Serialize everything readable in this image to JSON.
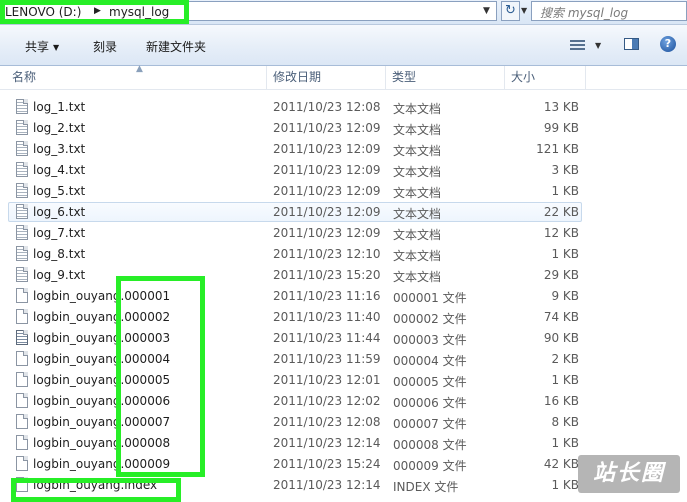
{
  "address_bar": {
    "drive": "LENOVO (D:)",
    "folder": "mysql_log"
  },
  "search": {
    "placeholder": "搜索 mysql_log"
  },
  "toolbar": {
    "share_label": "共享",
    "burn_label": "刻录",
    "new_folder_label": "新建文件夹"
  },
  "columns": {
    "name": "名称",
    "date": "修改日期",
    "type": "类型",
    "size": "大小"
  },
  "files": [
    {
      "name": "log_1.txt",
      "date": "2011/10/23 12:08",
      "type": "文本文档",
      "size": "13 KB"
    },
    {
      "name": "log_2.txt",
      "date": "2011/10/23 12:09",
      "type": "文本文档",
      "size": "99 KB"
    },
    {
      "name": "log_3.txt",
      "date": "2011/10/23 12:09",
      "type": "文本文档",
      "size": "121 KB"
    },
    {
      "name": "log_4.txt",
      "date": "2011/10/23 12:09",
      "type": "文本文档",
      "size": "3 KB"
    },
    {
      "name": "log_5.txt",
      "date": "2011/10/23 12:09",
      "type": "文本文档",
      "size": "1 KB"
    },
    {
      "name": "log_6.txt",
      "date": "2011/10/23 12:09",
      "type": "文本文档",
      "size": "22 KB"
    },
    {
      "name": "log_7.txt",
      "date": "2011/10/23 12:09",
      "type": "文本文档",
      "size": "12 KB"
    },
    {
      "name": "log_8.txt",
      "date": "2011/10/23 12:10",
      "type": "文本文档",
      "size": "1 KB"
    },
    {
      "name": "log_9.txt",
      "date": "2011/10/23 15:20",
      "type": "文本文档",
      "size": "29 KB"
    },
    {
      "name": "logbin_ouyang.000001",
      "date": "2011/10/23 11:16",
      "type": "000001 文件",
      "size": "9 KB"
    },
    {
      "name": "logbin_ouyang.000002",
      "date": "2011/10/23 11:40",
      "type": "000002 文件",
      "size": "74 KB"
    },
    {
      "name": "logbin_ouyang.000003",
      "date": "2011/10/23 11:44",
      "type": "000003 文件",
      "size": "90 KB"
    },
    {
      "name": "logbin_ouyang.000004",
      "date": "2011/10/23 11:59",
      "type": "000004 文件",
      "size": "2 KB"
    },
    {
      "name": "logbin_ouyang.000005",
      "date": "2011/10/23 12:01",
      "type": "000005 文件",
      "size": "1 KB"
    },
    {
      "name": "logbin_ouyang.000006",
      "date": "2011/10/23 12:02",
      "type": "000006 文件",
      "size": "16 KB"
    },
    {
      "name": "logbin_ouyang.000007",
      "date": "2011/10/23 12:08",
      "type": "000007 文件",
      "size": "8 KB"
    },
    {
      "name": "logbin_ouyang.000008",
      "date": "2011/10/23 12:14",
      "type": "000008 文件",
      "size": "1 KB"
    },
    {
      "name": "logbin_ouyang.000009",
      "date": "2011/10/23 15:24",
      "type": "000009 文件",
      "size": "42 KB"
    },
    {
      "name": "logbin_ouyang.index",
      "date": "2011/10/23 12:14",
      "type": "INDEX 文件",
      "size": "1 KB"
    }
  ],
  "selected_file": "log_6.txt",
  "highlight_color": "#27ee27",
  "watermark": "站长圈"
}
